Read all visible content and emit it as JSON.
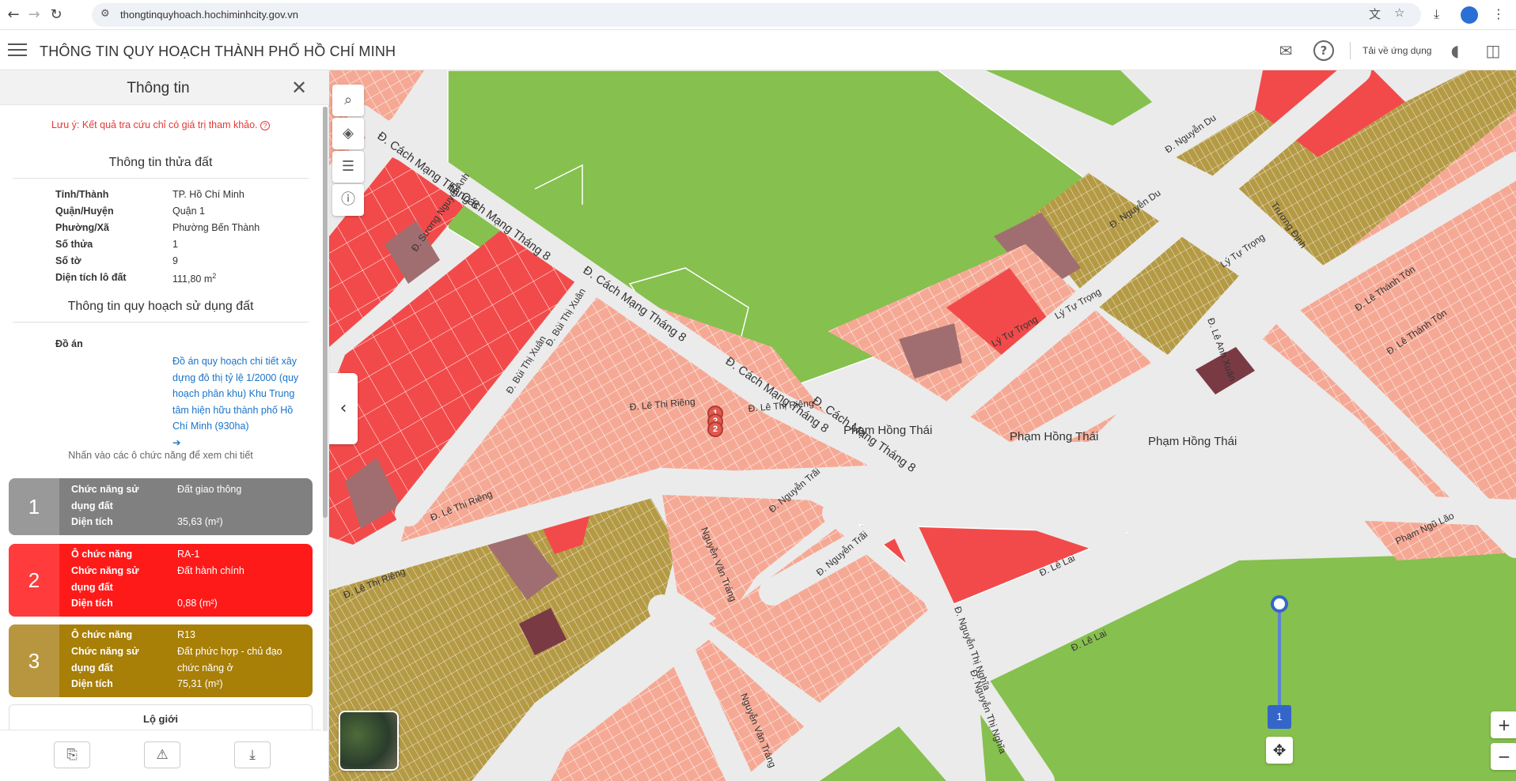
{
  "browser": {
    "url": "thongtinquyhoach.hochiminhcity.gov.vn"
  },
  "app": {
    "title": "THÔNG TIN QUY HOẠCH THÀNH PHỐ HỒ CHÍ MINH",
    "download_app": "Tải về ứng dụng"
  },
  "panel": {
    "title": "Thông tin",
    "note": "Lưu ý: Kết quả tra cứu chỉ có giá trị tham khảo.",
    "parcel_section": "Thông tin thửa đất",
    "parcel": [
      {
        "k": "Tỉnh/Thành",
        "v": "TP. Hồ Chí Minh"
      },
      {
        "k": "Quận/Huyện",
        "v": "Quận 1"
      },
      {
        "k": "Phường/Xã",
        "v": "Phường Bến Thành"
      },
      {
        "k": "Số thửa",
        "v": "1"
      },
      {
        "k": "Số tờ",
        "v": "9"
      },
      {
        "k": "Diện tích lô đất",
        "v": "111,80 m"
      }
    ],
    "area_sup": "2",
    "plan_section": "Thông tin quy hoạch sử dụng đất",
    "doan_label": "Đồ án",
    "doan_value": "Đồ án quy hoạch chi tiết xây dựng đô thị tỷ lệ 1/2000 (quy hoạch phân khu) Khu Trung tâm hiện hữu thành phố Hồ Chí Minh (930ha)",
    "hint": "Nhấn vào các ô chức năng để xem chi tiết",
    "cards": [
      {
        "num": "1",
        "rows": [
          {
            "k": "Chức năng sử dụng đất",
            "v": "Đất giao thông"
          },
          {
            "k": "Diện tích",
            "v": "35,63 (m²)"
          }
        ]
      },
      {
        "num": "2",
        "rows": [
          {
            "k": "Ô chức năng",
            "v": "RA-1"
          },
          {
            "k": "Chức năng sử dụng đất",
            "v": "Đất hành chính"
          },
          {
            "k": "Diện tích",
            "v": "0,88 (m²)"
          }
        ]
      },
      {
        "num": "3",
        "rows": [
          {
            "k": "Ô chức năng",
            "v": "R13"
          },
          {
            "k": "Chức năng sử dụng đất",
            "v": "Đất phức hợp - chủ đạo chức năng ở"
          },
          {
            "k": "Diện tích",
            "v": "75,31 (m²)"
          }
        ]
      }
    ],
    "lo_gioi": "Lộ giới"
  },
  "map": {
    "zoom_level": "1",
    "pins": [
      "1",
      "2",
      "2"
    ],
    "colors": {
      "green": "#86c04e",
      "red": "#f24a4a",
      "olive": "#b59a45",
      "salmon": "#f5a995",
      "mauve": "#a06e70",
      "road": "#ebebeb"
    },
    "street_labels": [
      "Đ. Cách Mạng Tháng 8",
      "Đ. Cách Mạng Tháng 8",
      "Đ. Cách Mạng Tháng 8",
      "Đ. Cách Mạng Tháng 8",
      "Đ. Cách Mạng Tháng 8",
      "Đ. Lê Thị Riêng",
      "Đ. Lê Thị Riêng",
      "Đ. Lê Thị Riêng",
      "Đ. Lê Thị Riêng",
      "Phạm Hồng Thái",
      "Phạm Hồng Thái",
      "Phạm Hồng Thái",
      "Lý Tự Trọng",
      "Lý Tự Trọng",
      "Lý Tự Trọng",
      "Đ. Nguyễn Thị Nghĩa",
      "Đ. Nguyễn Thị Nghĩa",
      "Đ. Lê Lai",
      "Đ. Lê Lai",
      "Đ. Nguyễn Trãi",
      "Đ. Nguyễn Trãi",
      "Nguyễn Văn Tráng",
      "Nguyễn Văn Tráng",
      "Đ. Bùi Thị Xuân",
      "Đ. Bùi Thị Xuân",
      "Đ. Sương Nguyệt Anh",
      "Đ. Nguyễn Du",
      "Đ. Nguyễn Du",
      "Đ. Lê Thánh Tôn",
      "Đ. Lê Thánh Tôn",
      "Trương Định",
      "Đ. Lê Anh Xuân",
      "Phạm Ngũ Lão"
    ]
  }
}
